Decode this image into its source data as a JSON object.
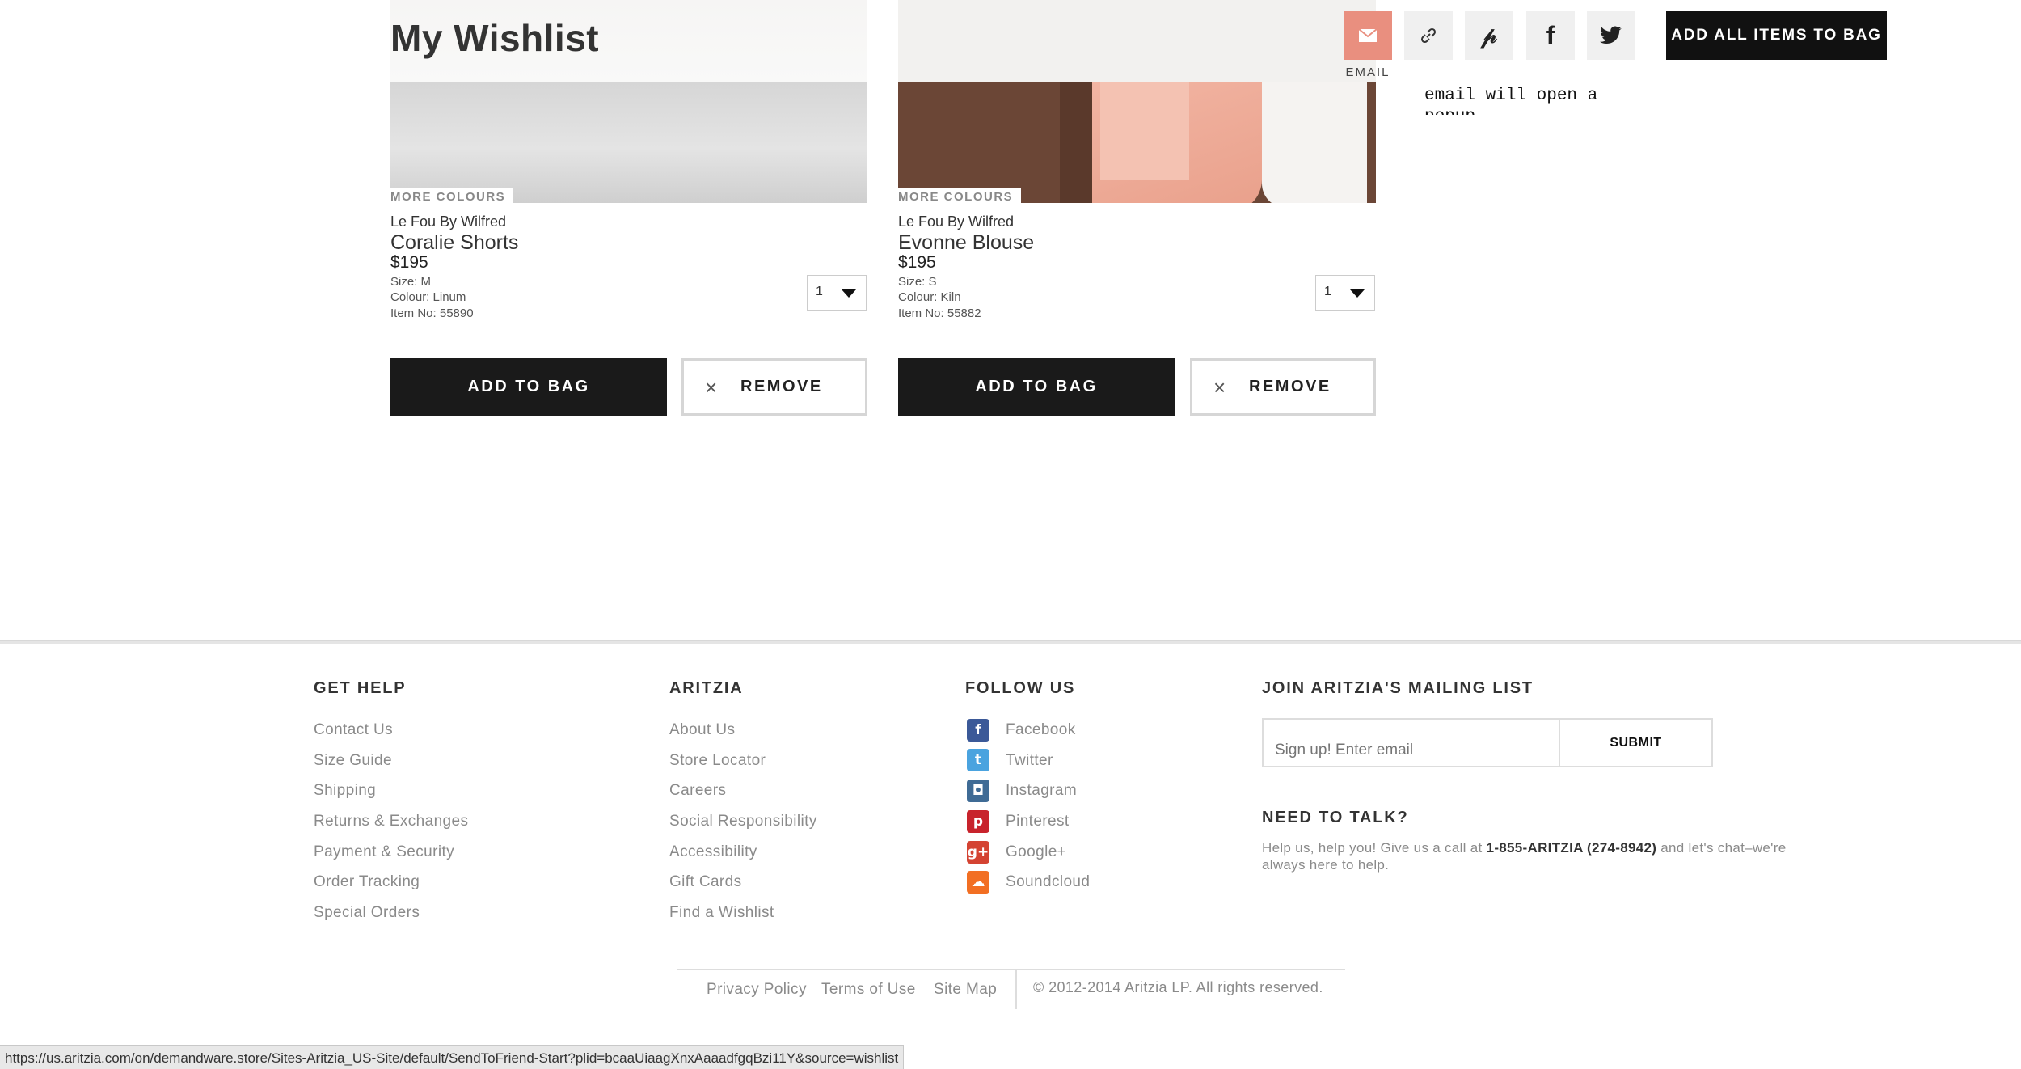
{
  "page": {
    "title": "My Wishlist"
  },
  "share": {
    "email_label": "EMAIL",
    "popup_note": "email will open a popup",
    "add_all_label": "ADD ALL ITEMS TO BAG",
    "icons": [
      "email-icon",
      "link-icon",
      "pinterest-icon",
      "facebook-icon",
      "twitter-icon"
    ],
    "email_color": "#e98f7f"
  },
  "items": [
    {
      "more_colours": "MORE COLOURS",
      "brand": "Le Fou By Wilfred",
      "name": "Coralie Shorts",
      "price": "$195",
      "size": "Size: M",
      "colour": "Colour: Linum",
      "item_no": "Item No: 55890",
      "qty": "1",
      "add_label": "ADD TO BAG",
      "remove_label": "REMOVE"
    },
    {
      "more_colours": "MORE COLOURS",
      "brand": "Le Fou By Wilfred",
      "name": "Evonne Blouse",
      "price": "$195",
      "size": "Size: S",
      "colour": "Colour: Kiln",
      "item_no": "Item No: 55882",
      "qty": "1",
      "add_label": "ADD TO BAG",
      "remove_label": "REMOVE"
    }
  ],
  "footer": {
    "get_help": {
      "heading": "GET HELP",
      "links": [
        "Contact Us",
        "Size Guide",
        "Shipping",
        "Returns & Exchanges",
        "Payment & Security",
        "Order Tracking",
        "Special Orders"
      ]
    },
    "aritzia": {
      "heading": "ARITZIA",
      "links": [
        "About Us",
        "Store Locator",
        "Careers",
        "Social Responsibility",
        "Accessibility",
        "Gift Cards",
        "Find a Wishlist"
      ]
    },
    "follow": {
      "heading": "FOLLOW US",
      "links": [
        "Facebook",
        "Twitter",
        "Instagram",
        "Pinterest",
        "Google+",
        "Soundcloud"
      ]
    },
    "mailing": {
      "heading": "JOIN ARITZIA'S MAILING LIST",
      "placeholder": "Sign up! Enter email",
      "submit": "SUBMIT"
    },
    "talk": {
      "heading": "NEED TO TALK?",
      "text_before": "Help us, help you! Give us a call at ",
      "phone": "1-855-ARITZIA (274-8942)",
      "text_after": " and let's chat–we're always here to help."
    },
    "bottom": {
      "privacy": "Privacy Policy",
      "terms": "Terms of Use",
      "sitemap": "Site Map",
      "copyright": "© 2012-2014 Aritzia LP. All rights reserved."
    }
  },
  "status_bar": {
    "url": "https://us.aritzia.com/on/demandware.store/Sites-Aritzia_US-Site/default/SendToFriend-Start?plid=bcaaUiaagXnxAaaadfgqBzi11Y&source=wishlist"
  }
}
